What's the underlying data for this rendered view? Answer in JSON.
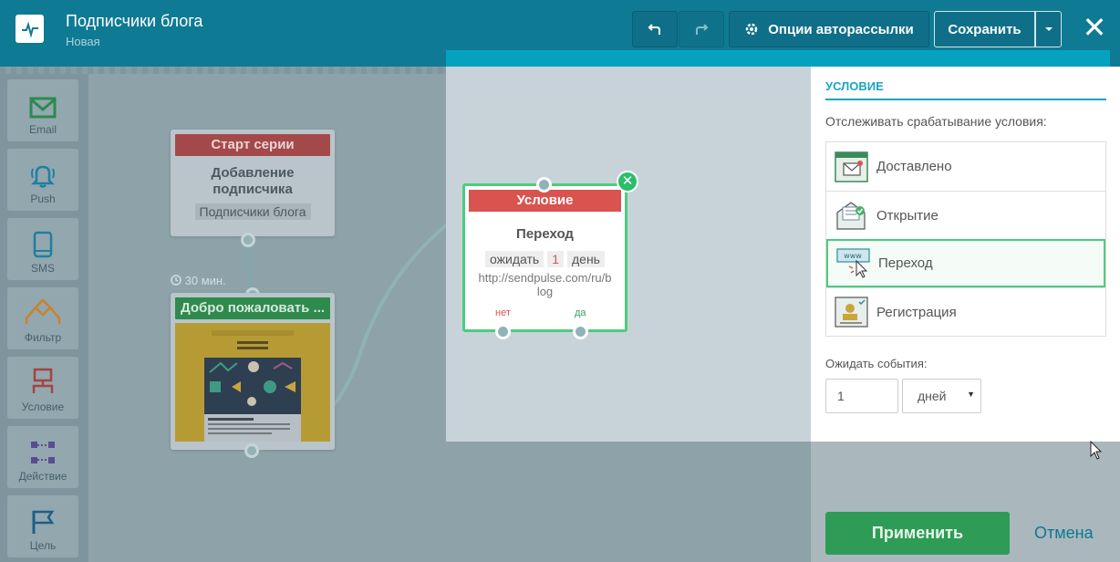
{
  "header": {
    "title": "Подписчики блога",
    "subtitle": "Новая",
    "options_label": "Опции авторассылки",
    "save_label": "Сохранить",
    "close_label": "✕"
  },
  "sidebar": {
    "items": [
      {
        "label": "Email",
        "icon": "envelope-icon"
      },
      {
        "label": "Push",
        "icon": "bell-icon"
      },
      {
        "label": "SMS",
        "icon": "phone-icon"
      },
      {
        "label": "Фильтр",
        "icon": "filter-icon"
      },
      {
        "label": "Условие",
        "icon": "condition-icon"
      },
      {
        "label": "Действие",
        "icon": "action-icon"
      },
      {
        "label": "Цель",
        "icon": "flag-icon"
      }
    ]
  },
  "canvas": {
    "start_node": {
      "header": "Старт серии",
      "title": "Добавление подписчика",
      "tag": "Подписчики блога"
    },
    "delay": "30 мин.",
    "email_node": {
      "header": "Добро пожаловать ..."
    },
    "condition_node": {
      "header": "Условие",
      "title": "Переход",
      "wait_label": "ожидать",
      "wait_value": "1",
      "wait_unit": "день",
      "url": "http://sendpulse.com/ru/blog",
      "no_label": "нет",
      "yes_label": "да"
    }
  },
  "panel": {
    "title": "УСЛОВИЕ",
    "question": "Отслеживать срабатывание условия:",
    "options": [
      {
        "label": "Доставлено",
        "icon": "delivered-icon",
        "selected": false
      },
      {
        "label": "Открытие",
        "icon": "opened-icon",
        "selected": false
      },
      {
        "label": "Переход",
        "icon": "click-icon",
        "selected": true
      },
      {
        "label": "Регистрация",
        "icon": "registration-icon",
        "selected": false
      }
    ],
    "wait_label": "Ожидать события:",
    "wait_value": "1",
    "wait_unit": "дней",
    "apply_label": "Применить",
    "cancel_label": "Отмена"
  }
}
